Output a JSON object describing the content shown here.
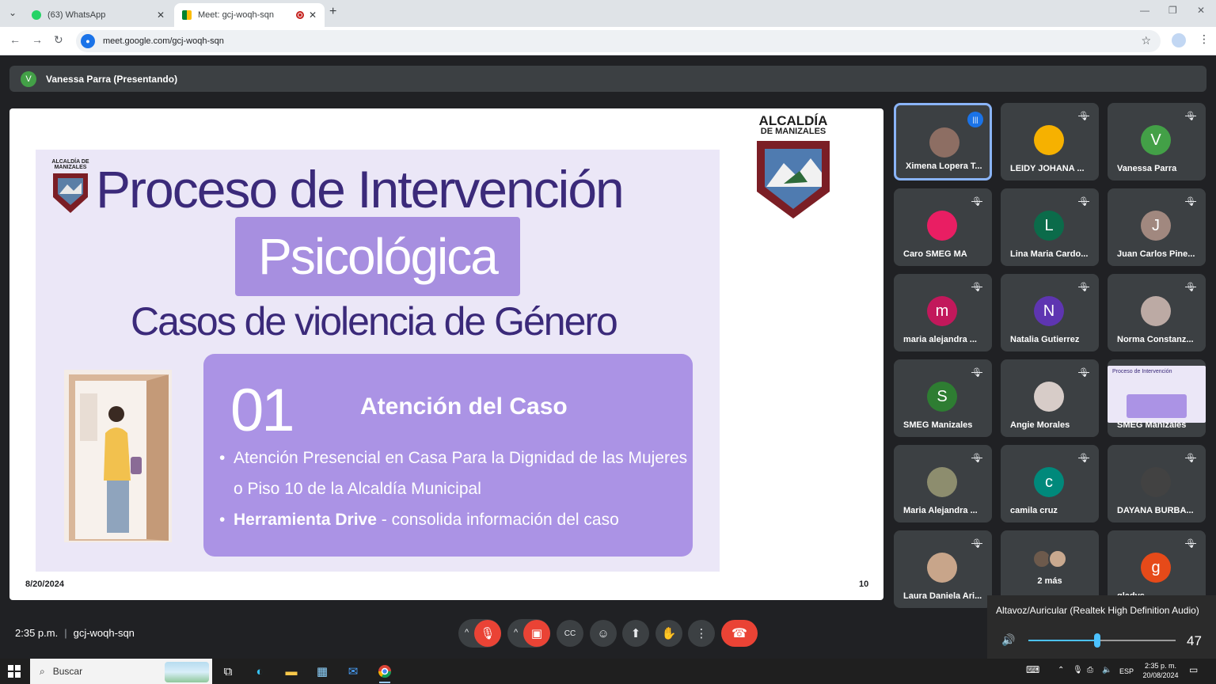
{
  "browser": {
    "tabs": [
      {
        "title": "(63) WhatsApp"
      },
      {
        "title": "Meet: gcj-woqh-sqn"
      }
    ],
    "url": "meet.google.com/gcj-woqh-sqn"
  },
  "meet": {
    "presenter_initial": "V",
    "presenter_label": "Vanessa Parra (Presentando)",
    "meeting_time": "2:35 p.m.",
    "meeting_code": "gcj-woqh-sqn"
  },
  "slide": {
    "logo_small_text": "ALCALDÍA DE MANIZALES",
    "title_line1": "Proceso de Intervención",
    "title_line2": "Psicológica",
    "title_line3": "Casos de violencia de Género",
    "number": "01",
    "card_heading": "Atención del Caso",
    "bullet1": "Atención Presencial en Casa Para la Dignidad de las Mujeres o Piso 10 de la Alcaldía Municipal",
    "bullet2_bold": "Herramienta Drive",
    "bullet2_rest": " - consolida información del caso",
    "logo_big_title": "ALCALDÍA",
    "logo_big_sub": "DE MANIZALES",
    "date": "8/20/2024",
    "page": "10"
  },
  "participants": [
    {
      "name": "Ximena Lopera T...",
      "initial": "",
      "color": "#8d6e63",
      "type": "photo",
      "speaking": true
    },
    {
      "name": "LEIDY JOHANA ...",
      "initial": "",
      "color": "#f6b100",
      "type": "photo"
    },
    {
      "name": "Vanessa Parra",
      "initial": "V",
      "color": "#43a047",
      "type": "letter"
    },
    {
      "name": "Caro SMEG MA",
      "initial": "",
      "color": "#e91e63",
      "type": "photo"
    },
    {
      "name": "Lina Maria Cardo...",
      "initial": "L",
      "color": "#0b6b4a",
      "type": "letter"
    },
    {
      "name": "Juan Carlos Pine...",
      "initial": "J",
      "color": "#a1887f",
      "type": "letter"
    },
    {
      "name": "maria alejandra ...",
      "initial": "m",
      "color": "#c2185b",
      "type": "letter"
    },
    {
      "name": "Natalia Gutierrez",
      "initial": "N",
      "color": "#5e35b1",
      "type": "letter"
    },
    {
      "name": "Norma Constanz...",
      "initial": "",
      "color": "#bcaaa4",
      "type": "photo"
    },
    {
      "name": "SMEG Manizales",
      "initial": "S",
      "color": "#2e7d32",
      "type": "letter"
    },
    {
      "name": "Angie Morales",
      "initial": "",
      "color": "#d7ccc8",
      "type": "photo"
    },
    {
      "name": "SMEG Manizales",
      "initial": "",
      "color": "#ebe7f7",
      "type": "screen"
    },
    {
      "name": "Maria Alejandra ...",
      "initial": "",
      "color": "#8d8d6e",
      "type": "photo"
    },
    {
      "name": "camila cruz",
      "initial": "c",
      "color": "#00897b",
      "type": "letter"
    },
    {
      "name": "DAYANA BURBA...",
      "initial": "",
      "color": "#424242",
      "type": "photo"
    },
    {
      "name": "Laura Daniela Ari...",
      "initial": "",
      "color": "#c8a58a",
      "type": "photo"
    },
    {
      "name": "2 más",
      "initial": "",
      "color": "#8d6e63",
      "type": "more"
    },
    {
      "name": "gladys",
      "initial": "g",
      "color": "#e64a19",
      "type": "letter"
    }
  ],
  "volume": {
    "device": "Altavoz/Auricular (Realtek High Definition Audio)",
    "level": 47
  },
  "taskbar": {
    "search_label": "Buscar",
    "lang": "ESP",
    "time": "2:35 p. m.",
    "date": "20/08/2024"
  },
  "icons": {
    "mic_off": "mic-off-icon",
    "cam_off": "camera-off-icon",
    "captions": "captions-icon",
    "emoji": "emoji-icon",
    "present": "present-icon",
    "hand": "raise-hand-icon",
    "more": "more-options-icon",
    "hangup": "hangup-icon"
  }
}
